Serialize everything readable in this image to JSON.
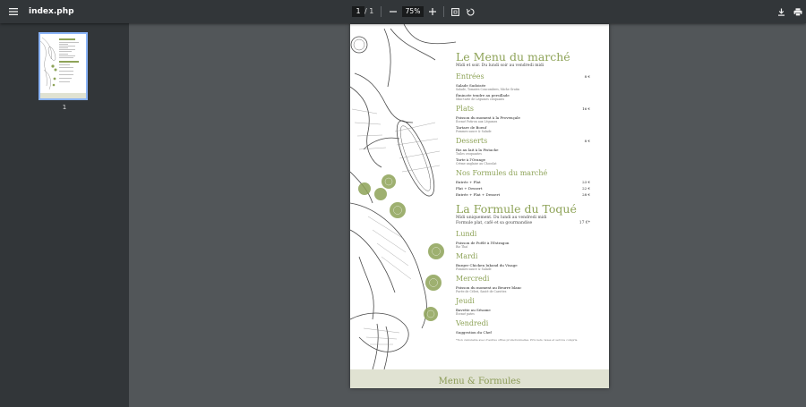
{
  "toolbar": {
    "title": "index.php",
    "page_current": "1",
    "page_separator": "/",
    "page_total": "1",
    "zoom_value": "75%"
  },
  "sidebar": {
    "thumb_number": "1"
  },
  "document": {
    "title1": "Le Menu du marché",
    "subtitle1": "Midi et soir. Du lundi soir au vendredi midi",
    "sections": [
      {
        "name": "Entrées",
        "price": "8 €",
        "items": [
          {
            "name": "Salade Sudoisée",
            "desc": "Salade, Tomates Concombres, Miche Gratin"
          },
          {
            "name": "Émincée tendre au persillade",
            "desc": "Mini-tarte de Légumes croquants"
          }
        ]
      },
      {
        "name": "Plats",
        "price": "16 €",
        "items": [
          {
            "name": "Poisson du moment à la Provençale",
            "desc": "Écrasé Potiron aux Légumes"
          },
          {
            "name": "Tartare de Boeuf",
            "desc": "Pommes sauce & Salade"
          }
        ]
      },
      {
        "name": "Desserts",
        "price": "8 €",
        "items": [
          {
            "name": "Riz au lait à la Pistache",
            "desc": "Tuiles croquantes"
          },
          {
            "name": "Tarte à l'Orange",
            "desc": "Crème anglaise au Chocolat"
          }
        ]
      }
    ],
    "formules_title": "Nos Formules du marché",
    "formules": [
      {
        "name": "Entrée + Plat",
        "price": "23 €"
      },
      {
        "name": "Plat + Dessert",
        "price": "22 €"
      },
      {
        "name": "Entrée + Plat + Dessert",
        "price": "28 €"
      }
    ],
    "title2": "La Formule du Toqué",
    "subtitle2": "Midi uniquement. Du lundi au vendredi midi",
    "subtitle2b": "Formule plat, café et sa gourmandise",
    "subtitle2b_price": "17 €*",
    "days": [
      {
        "name": "Lundi",
        "item": "Poisson de Poêlé à l'Estragon",
        "desc": "Riz Thaï"
      },
      {
        "name": "Mardi",
        "item": "Burger Chicken Iukond du Visage",
        "desc": "Pommes sauce & Salade"
      },
      {
        "name": "Mercredi",
        "item": "Poisson du moment au Beurre blanc",
        "desc": "Purée de Céleri, Sauté de Carottes"
      },
      {
        "name": "Jeudi",
        "item": "Bavette au Sésame",
        "desc": "Écrasé pates"
      },
      {
        "name": "Vendredi",
        "item": "Suggestion du Chef",
        "desc": ""
      }
    ],
    "footnote": "*Non cumulable avec d'autres offres promotionnelles. Prix nets, taxes et service compris.",
    "footer": "Menu & Formules"
  },
  "colors": {
    "accent": "#8ea358",
    "toolbar": "#323639",
    "viewer": "#525659",
    "thumb_border": "#8ab4f8"
  },
  "icons": [
    "menu-icon",
    "minus-icon",
    "plus-icon",
    "fit-page-icon",
    "rotate-icon",
    "download-icon",
    "print-icon"
  ]
}
